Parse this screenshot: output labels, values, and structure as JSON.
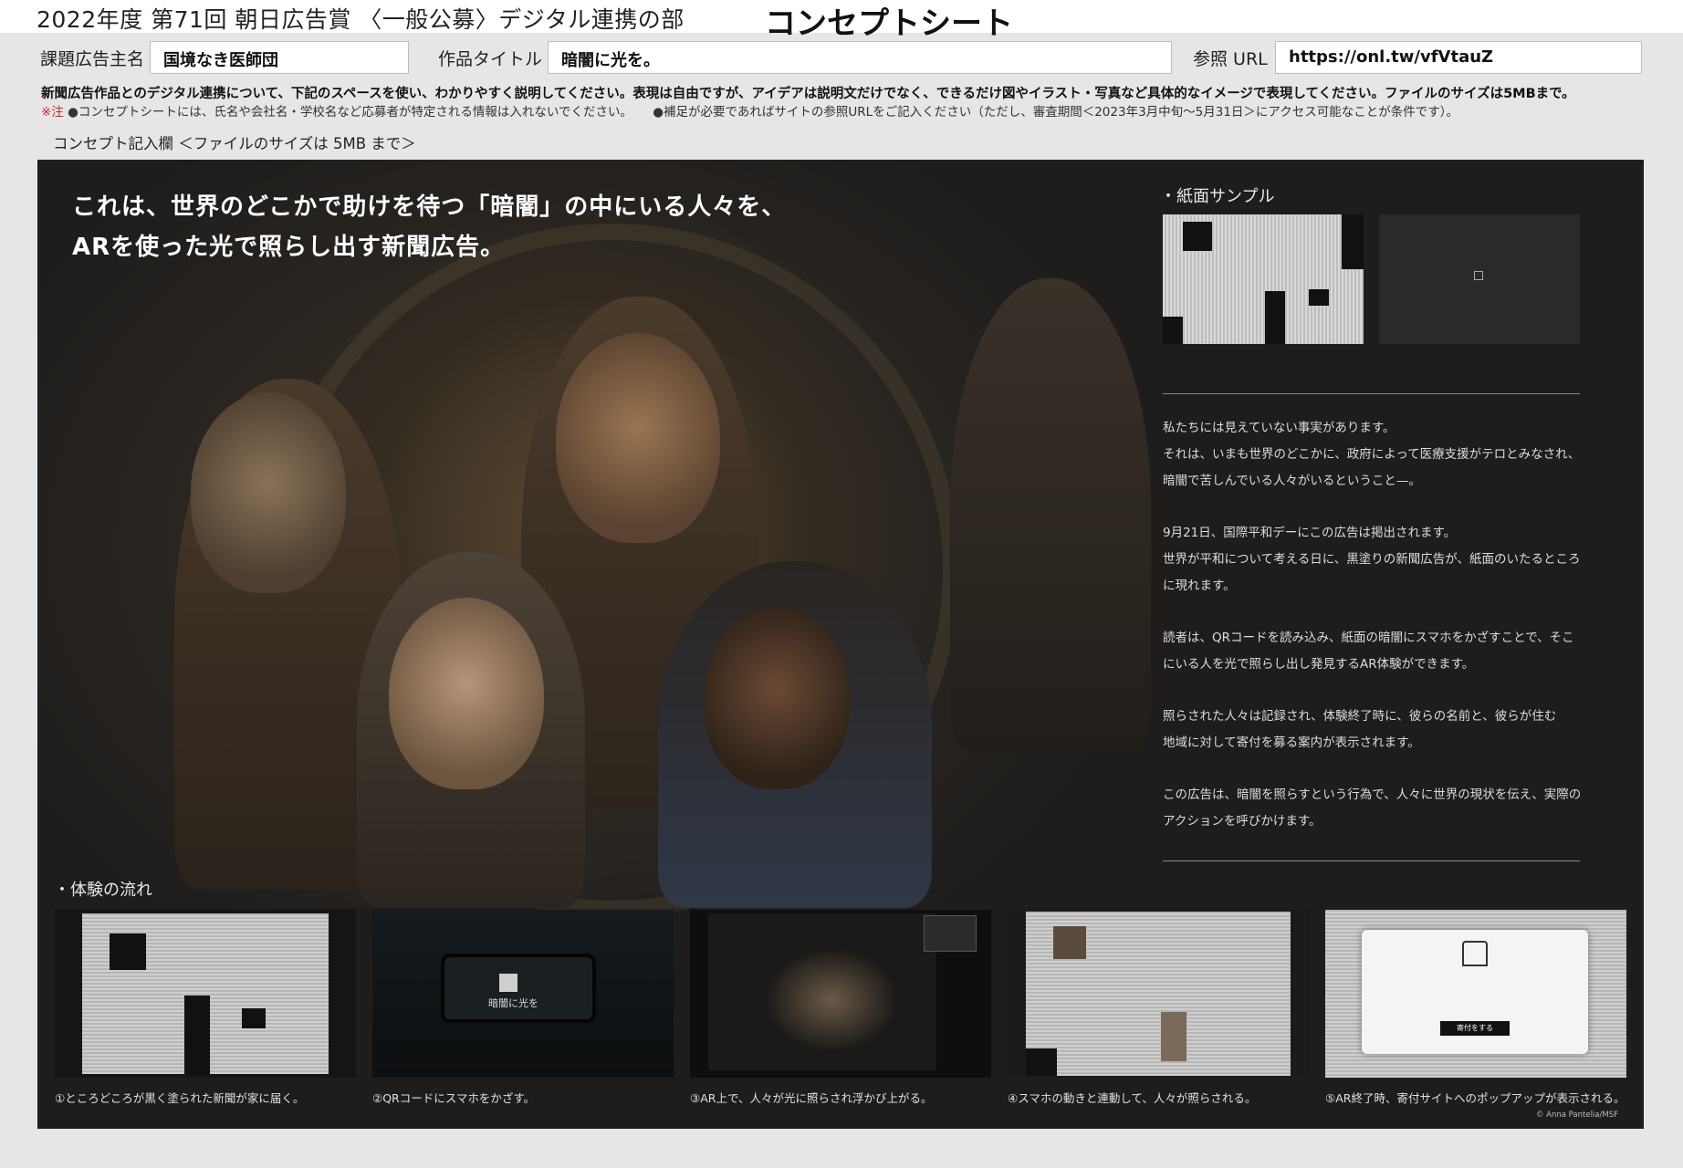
{
  "header": {
    "title": "2022年度 第71回 朝日広告賞 〈一般公募〉デジタル連携の部",
    "concept": "コンセプトシート"
  },
  "fields": {
    "advertiser_label": "課題広告主名",
    "advertiser_value": "国境なき医師団",
    "title_label": "作品タイトル",
    "title_value": "暗闇に光を。",
    "url_label": "参照 URL",
    "url_value": "https://onl.tw/vfVtauZ"
  },
  "instruction": "新聞広告作品とのデジタル連携について、下記のスペースを使い、わかりやすく説明してください。表現は自由ですが、アイデアは説明文だけでなく、できるだけ図やイラスト・写真など具体的なイメージで表現してください。ファイルのサイズは5MBまで。",
  "notes": {
    "mark": "※注",
    "note1": "●コンセプトシートには、氏名や会社名・学校名など応募者が特定される情報は入れないでください。",
    "note2": "●補足が必要であればサイトの参照URLをご記入ください（ただし、審査期間＜2023年3月中旬〜5月31日＞にアクセス可能なことが条件です）。"
  },
  "concept_label": "コンセプト記入欄 ＜ファイルのサイズは 5MB まで＞",
  "panel": {
    "headline_line1": "これは、世界のどこかで助けを待つ「暗闇」の中にいる人々を、",
    "headline_line2": "ARを使った光で照らし出す新聞広告。",
    "sample_title": "・紙面サンプル",
    "description": [
      "私たちには見えていない事実があります。",
      "それは、いまも世界のどこかに、政府によって医療支援がテロとみなされ、",
      "暗闇で苦しんでいる人々がいるということ—。",
      "9月21日、国際平和デーにこの広告は掲出されます。",
      "世界が平和について考える日に、黒塗りの新聞広告が、紙面のいたるところ",
      "に現れます。",
      "読者は、QRコードを読み込み、紙面の暗闇にスマホをかざすことで、そこ",
      "にいる人を光で照らし出し発見するAR体験ができます。",
      "照らされた人々は記録され、体験終了時に、彼らの名前と、彼らが住む",
      "地域に対して寄付を募る案内が表示されます。",
      "この広告は、暗闇を照らすという行為で、人々に世界の現状を伝え、実際の",
      "アクションを呼びかけます。"
    ],
    "flow_title": "・体験の流れ",
    "steps": [
      "①ところどころが黒く塗られた新聞が家に届く。",
      "②QRコードにスマホをかざす。",
      "③AR上で、人々が光に照らされ浮かび上がる。",
      "④スマホの動きと連動して、人々が照らされる。",
      "⑤AR終了時、寄付サイトへのポップアップが表示される。"
    ],
    "phone_screen_text": "暗闇に光を",
    "popup_button": "寄付をする",
    "credit": "© Anna Pantelia/MSF"
  }
}
